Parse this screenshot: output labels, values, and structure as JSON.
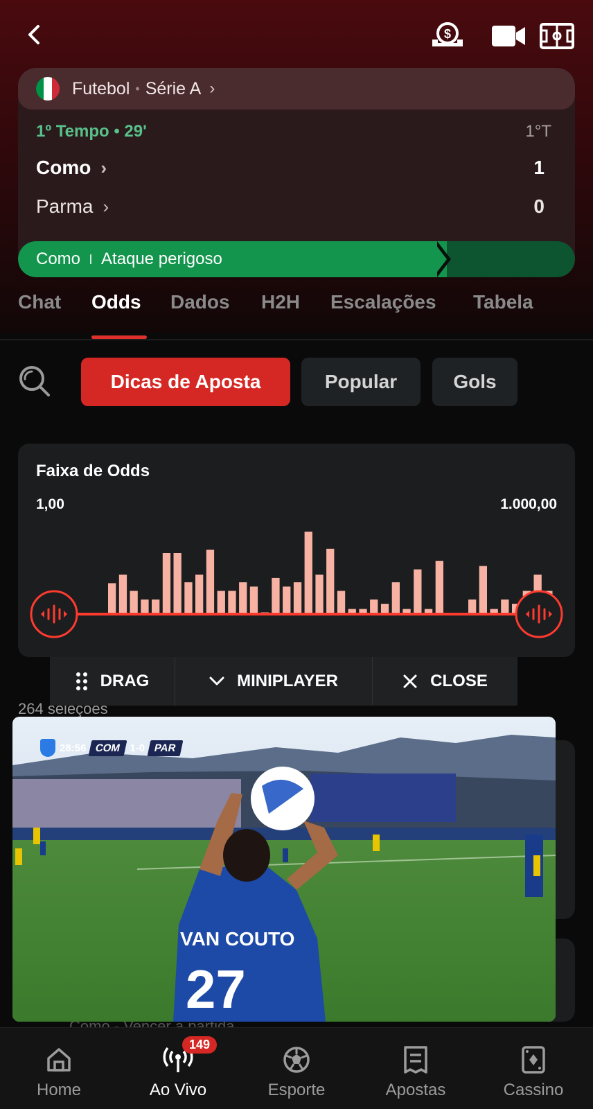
{
  "header": {
    "back_icon": "chevron-left-icon",
    "icons": [
      "cash-out-icon",
      "video-camera-icon",
      "pitch-field-icon"
    ]
  },
  "match": {
    "sport": "Futebol",
    "league": "Série A",
    "flag_colors": [
      "#009246",
      "#ffffff",
      "#ce2b37"
    ],
    "period": "1º Tempo • 29'",
    "period_short": "1°T",
    "home": {
      "name": "Como",
      "score": "1"
    },
    "away": {
      "name": "Parma",
      "score": "0"
    },
    "event": {
      "team": "Como",
      "text": "Ataque perigoso",
      "possession": 0.77
    }
  },
  "tabs": [
    {
      "label": "Chat"
    },
    {
      "label": "Odds",
      "active": true
    },
    {
      "label": "Dados"
    },
    {
      "label": "H2H"
    },
    {
      "label": "Escalações"
    },
    {
      "label": "Tabela"
    }
  ],
  "filters": {
    "search_icon": "search-icon",
    "chips": [
      {
        "label": "Dicas de Aposta",
        "active": true
      },
      {
        "label": "Popular"
      },
      {
        "label": "Gols"
      }
    ]
  },
  "odds_range": {
    "title": "Faixa de Odds",
    "min_label": "1,00",
    "max_label": "1.000,00",
    "range": [
      0,
      1
    ],
    "accent": "#ff3b30",
    "bar_color": "#f8b2a4",
    "bars": [
      0.36,
      0.46,
      0.27,
      0.17,
      0.17,
      0.71,
      0.71,
      0.37,
      0.46,
      0.75,
      0.27,
      0.27,
      0.37,
      0.32,
      0.02,
      0.42,
      0.32,
      0.37,
      0.96,
      0.46,
      0.76,
      0.27,
      0.06,
      0.06,
      0.17,
      0.12,
      0.37,
      0.06,
      0.52,
      0.06,
      0.62,
      0.0,
      0.0,
      0.17,
      0.56,
      0.06,
      0.17,
      0.12,
      0.27,
      0.46,
      0.27
    ]
  },
  "miniplayer": {
    "drag_label": "DRAG",
    "mini_label": "MINIPLAYER",
    "close_label": "CLOSE",
    "selections": "264 seleções",
    "scorebug": {
      "time": "28:56",
      "home": "COM",
      "score": "1-0",
      "away": "PAR"
    },
    "jersey_name": "VAN COUTO",
    "jersey_number": "27",
    "behind_text": "Como - Vencer a partida"
  },
  "bottom_nav": [
    {
      "label": "Home",
      "icon": "home-icon"
    },
    {
      "label": "Ao Vivo",
      "icon": "live-broadcast-icon",
      "badge": "149",
      "active": true
    },
    {
      "label": "Esporte",
      "icon": "soccer-ball-icon"
    },
    {
      "label": "Apostas",
      "icon": "betslip-icon"
    },
    {
      "label": "Cassino",
      "icon": "playing-card-icon"
    }
  ]
}
